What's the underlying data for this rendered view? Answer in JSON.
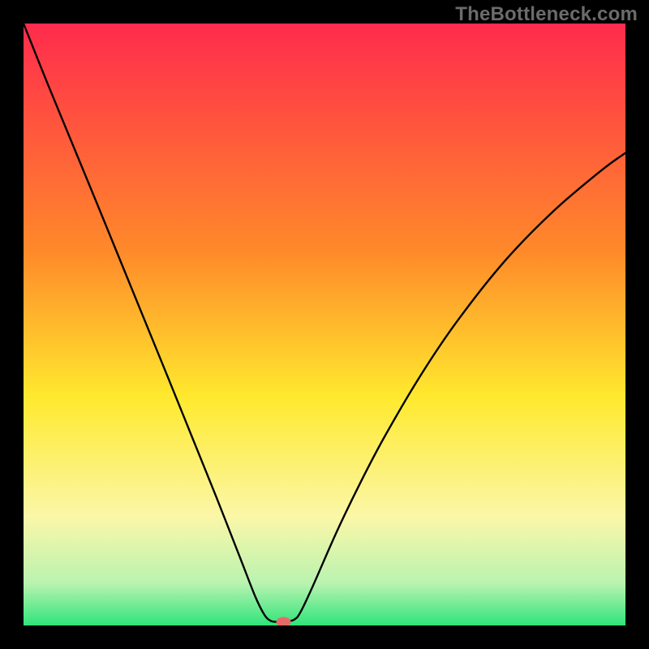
{
  "watermark": "TheBottleneck.com",
  "chart_data": {
    "type": "line",
    "title": "",
    "xlabel": "",
    "ylabel": "",
    "xlim": [
      0,
      100
    ],
    "ylim": [
      0,
      100
    ],
    "series": [
      {
        "name": "bottleneck-curve",
        "x": [
          0,
          4,
          8,
          12,
          16,
          20,
          24,
          28,
          32,
          36,
          38.5,
          40,
          41,
          42,
          43.5,
          45,
          46,
          48,
          52,
          56,
          60,
          66,
          72,
          80,
          88,
          96,
          100
        ],
        "y": [
          100,
          90,
          80.3,
          70.6,
          60.8,
          51,
          41.2,
          31.3,
          21.4,
          11.2,
          4.8,
          1.8,
          0.8,
          0.6,
          0.6,
          1.0,
          2.2,
          6.4,
          15.5,
          23.8,
          31.4,
          41.6,
          50.5,
          60.6,
          68.8,
          75.6,
          78.5
        ]
      }
    ],
    "marker": {
      "x": 43.2,
      "y": 0.6,
      "fill": "#e66a6a"
    },
    "gradient_stops": [
      {
        "offset": 0,
        "color": "#ff2b4d"
      },
      {
        "offset": 38,
        "color": "#ff8a2a"
      },
      {
        "offset": 62,
        "color": "#ffe92e"
      },
      {
        "offset": 82,
        "color": "#fbf7a8"
      },
      {
        "offset": 93,
        "color": "#b9f3b0"
      },
      {
        "offset": 100,
        "color": "#2fe47a"
      }
    ]
  }
}
